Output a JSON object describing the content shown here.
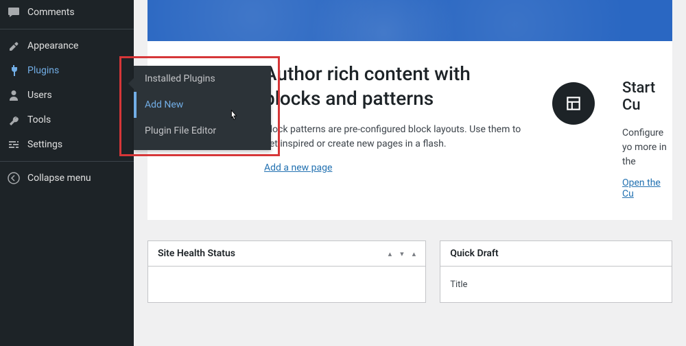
{
  "sidebar": {
    "items": [
      {
        "label": "Comments"
      },
      {
        "label": "Appearance"
      },
      {
        "label": "Plugins"
      },
      {
        "label": "Users"
      },
      {
        "label": "Tools"
      },
      {
        "label": "Settings"
      },
      {
        "label": "Collapse menu"
      }
    ]
  },
  "flyout": {
    "items": [
      {
        "label": "Installed Plugins"
      },
      {
        "label": "Add New"
      },
      {
        "label": "Plugin File Editor"
      }
    ]
  },
  "content": {
    "heading": "Author rich content with blocks and patterns",
    "body": "Block patterns are pre-configured block layouts. Use them to get inspired or create new pages in a flash.",
    "link": "Add a new page"
  },
  "customize": {
    "heading": "Start Cu",
    "body": "Configure yo more in the",
    "link": "Open the Cu"
  },
  "panels": {
    "health": "Site Health Status",
    "draft": "Quick Draft",
    "title_label": "Title"
  }
}
